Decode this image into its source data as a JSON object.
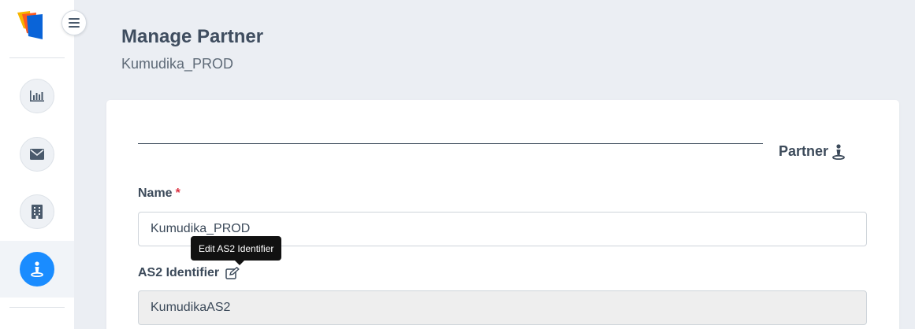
{
  "header": {
    "title": "Manage Partner",
    "subtitle": "Kumudika_PROD"
  },
  "sidebar": {
    "items": [
      {
        "icon": "bar-chart-icon",
        "active": false
      },
      {
        "icon": "envelope-icon",
        "active": false
      },
      {
        "icon": "building-icon",
        "active": false
      },
      {
        "icon": "partner-icon",
        "active": true
      }
    ]
  },
  "section": {
    "heading": "Partner"
  },
  "form": {
    "name": {
      "label": "Name",
      "required_mark": "*",
      "value": "Kumudika_PROD"
    },
    "as2_identifier": {
      "label": "AS2 Identifier",
      "value": "KumudikaAS2",
      "tooltip": "Edit AS2 Identifier"
    }
  },
  "colors": {
    "accent": "#1a8cff",
    "required": "#dc3545",
    "tooltip_bg": "#111111"
  }
}
